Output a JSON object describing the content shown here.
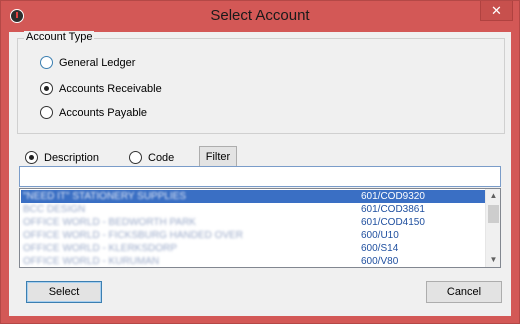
{
  "window": {
    "title": "Select Account",
    "close_glyph": "✕"
  },
  "account_type": {
    "legend": "Account Type",
    "options": [
      {
        "label": "General Ledger",
        "checked": false
      },
      {
        "label": "Accounts Receivable",
        "checked": true
      },
      {
        "label": "Accounts Payable",
        "checked": false
      }
    ]
  },
  "search_by": {
    "options": [
      {
        "label": "Description",
        "checked": true
      },
      {
        "label": "Code",
        "checked": false
      }
    ],
    "filter_label": "Filter"
  },
  "search": {
    "value": ""
  },
  "accounts": [
    {
      "description": "\"NEED IT\" STATIONERY SUPPLIES",
      "code": "601/COD9320",
      "selected": true
    },
    {
      "description": "BCC DESIGN",
      "code": "601/COD3861",
      "selected": false
    },
    {
      "description": "OFFICE WORLD - BEDWORTH PARK",
      "code": "601/COD4150",
      "selected": false
    },
    {
      "description": "OFFICE WORLD - FICKSBURG HANDED OVER",
      "code": "600/U10",
      "selected": false
    },
    {
      "description": "OFFICE WORLD - KLERKSDORP",
      "code": "600/S14",
      "selected": false
    },
    {
      "description": "OFFICE WORLD - KURUMAN",
      "code": "600/V80",
      "selected": false
    }
  ],
  "buttons": {
    "select": "Select",
    "cancel": "Cancel"
  },
  "colors": {
    "titlebar": "#d35856",
    "selection": "#3a6fc4",
    "code_text": "#1f4f9f"
  }
}
